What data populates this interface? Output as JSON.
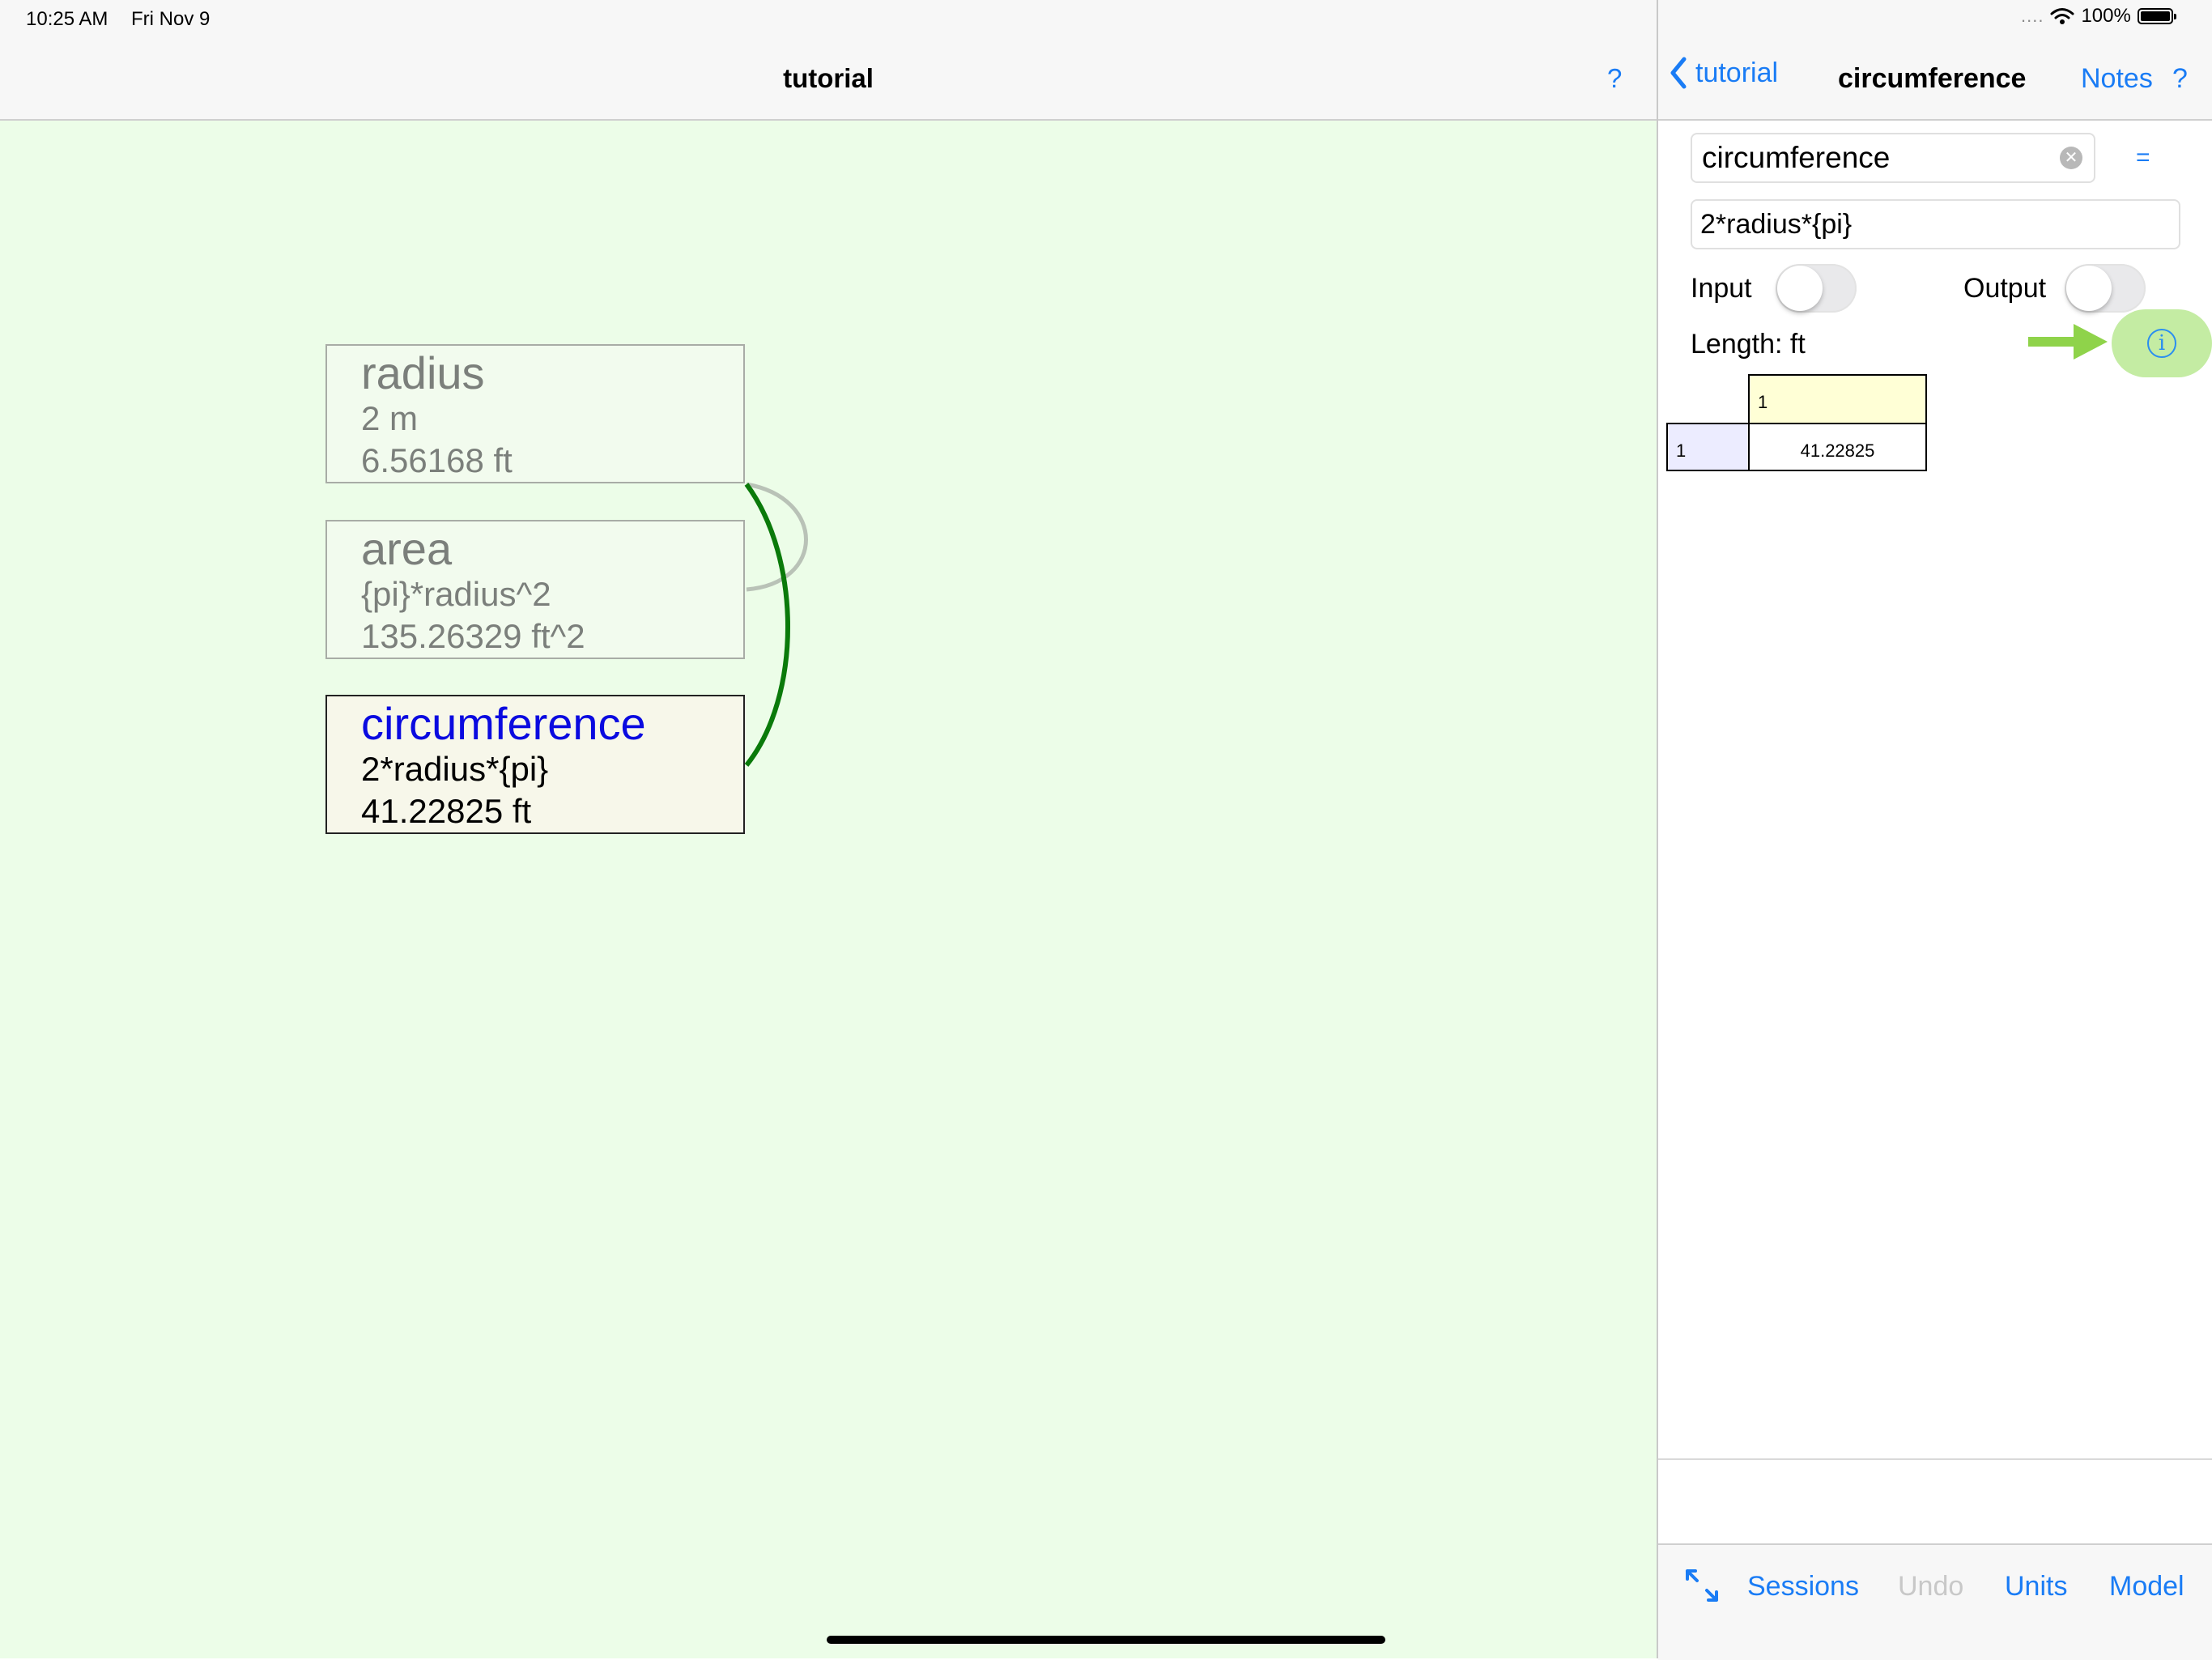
{
  "status": {
    "time": "10:25 AM",
    "date": "Fri Nov 9",
    "signal_dots": "....",
    "battery": "100%"
  },
  "left": {
    "title": "tutorial",
    "help": "?",
    "nodes": [
      {
        "name": "radius",
        "line1": "2 m",
        "line2": "6.56168 ft"
      },
      {
        "name": "area",
        "line1": "{pi}*radius^2",
        "line2": "135.26329 ft^2"
      },
      {
        "name": "circumference",
        "line1": "2*radius*{pi}",
        "line2": "41.22825 ft"
      }
    ]
  },
  "right": {
    "back_label": "tutorial",
    "title": "circumference",
    "notes_label": "Notes",
    "help": "?",
    "name_value": "circumference",
    "equals": "=",
    "formula_value": "2*radius*{pi}",
    "input_label": "Input",
    "input_on": false,
    "output_label": "Output",
    "output_on": false,
    "length_label": "Length: ft",
    "info_glyph": "i",
    "table": {
      "col_header": "1",
      "row_header": "1",
      "value": "41.22825"
    },
    "toolbar": {
      "sessions": "Sessions",
      "undo": "Undo",
      "units": "Units",
      "model": "Model"
    }
  },
  "colors": {
    "accent": "#1a7cf5",
    "canvas_bg": "#ecfde8",
    "selected_name": "#0a0ae0",
    "link_active": "#0a7a0a",
    "link_inactive": "#b9c2b7",
    "highlight": "#c4eca3"
  },
  "icons": [
    "chevron-left-icon",
    "clear-icon",
    "wifi-icon",
    "battery-icon",
    "arrow-right-icon",
    "info-icon",
    "expand-icon"
  ]
}
